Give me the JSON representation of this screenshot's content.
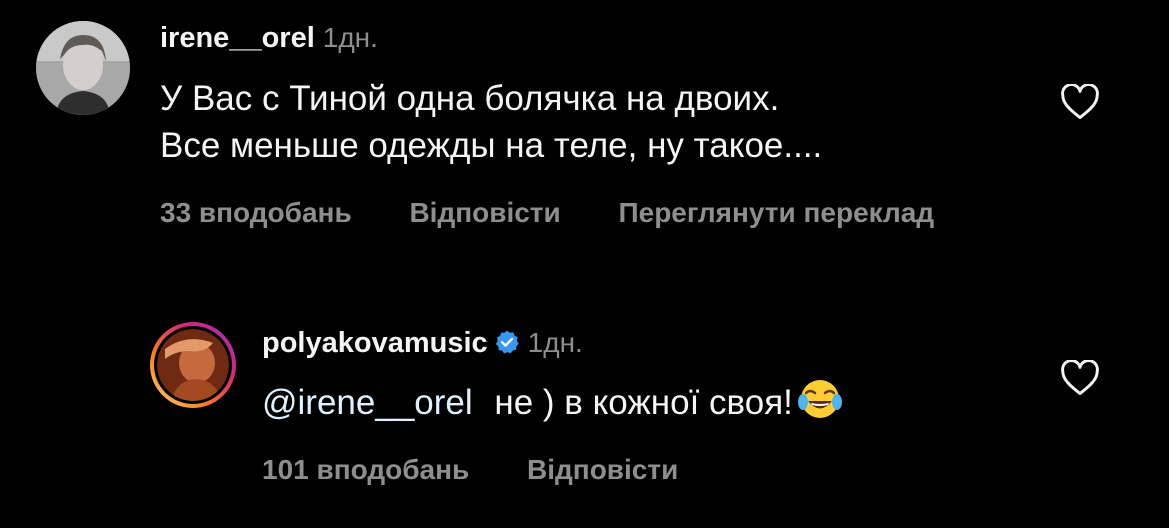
{
  "comments": [
    {
      "username": "irene__orel",
      "time": "1дн.",
      "text_line1": "У Вас с Тиной одна болячка на двоих.",
      "text_line2": "Все меньше одежды на теле, ну такое....",
      "likes": "33 вподобань",
      "reply": "Відповісти",
      "translate": "Переглянути переклад",
      "heart_icon": "heart-outline-icon"
    },
    {
      "username": "polyakovamusic",
      "verified": true,
      "time": "1дн.",
      "mention": "@irene__orel",
      "text": " не ) в кожної своя!",
      "emoji": "😂",
      "likes": "101 вподобань",
      "reply": "Відповісти",
      "heart_icon": "heart-outline-icon"
    }
  ],
  "colors": {
    "background": "#000000",
    "primary_text": "#f5f5f5",
    "secondary_text": "#8e8e8e",
    "mention": "#e0f1ff",
    "verified": "#3897f0"
  }
}
